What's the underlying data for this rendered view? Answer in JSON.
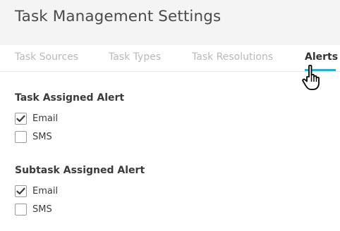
{
  "header": {
    "title": "Task Management Settings"
  },
  "tabs": [
    {
      "label": "Task Sources",
      "active": false
    },
    {
      "label": "Task Types",
      "active": false
    },
    {
      "label": "Task Resolutions",
      "active": false
    },
    {
      "label": "Alerts",
      "active": true
    }
  ],
  "sections": [
    {
      "title": "Task Assigned Alert",
      "options": [
        {
          "label": "Email",
          "checked": true
        },
        {
          "label": "SMS",
          "checked": false
        }
      ]
    },
    {
      "title": "Subtask Assigned Alert",
      "options": [
        {
          "label": "Email",
          "checked": true
        },
        {
          "label": "SMS",
          "checked": false
        }
      ]
    }
  ],
  "colors": {
    "accent": "#27b2c9",
    "header_bg": "#f4f4f5"
  },
  "icons": {
    "check": "checkmark-icon",
    "cursor": "hand-pointer-cursor-icon"
  }
}
